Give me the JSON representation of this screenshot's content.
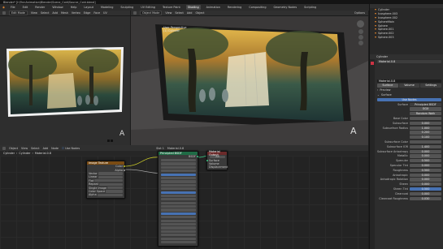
{
  "window_title": "Blender* [I:\\FinnAnimation\\Blender\\Scene_Cold\\Source_Cold.blend]",
  "menu": [
    "File",
    "Edit",
    "Render",
    "Window",
    "Help"
  ],
  "workspaces": [
    "Layout",
    "Modeling",
    "Sculpting",
    "UV Editing",
    "Texture Paint",
    "Shading",
    "Animation",
    "Rendering",
    "Compositing",
    "Geometry Nodes",
    "Scripting"
  ],
  "active_workspace": "Shading",
  "scene": "Scene",
  "view_layer": "ViewLayer",
  "left_view": {
    "header": {
      "mode": "Edit Mode",
      "menus": [
        "View",
        "Select",
        "Add",
        "Mesh",
        "Vertex",
        "Edge",
        "Face",
        "UV"
      ]
    },
    "label": "A"
  },
  "right_view": {
    "header": {
      "mode": "Object Mode",
      "menus": [
        "View",
        "Select",
        "Add",
        "Object"
      ],
      "shading": "Options"
    },
    "overlay_title": "User Perspective",
    "overlay_subtitle": "(1) Cylinder",
    "label": "A"
  },
  "outliner": {
    "items": [
      "Cylinder",
      "Icosphere.003",
      "Icosphere.002",
      "SphereMain",
      "Sphere",
      "Sphere.001",
      "Sphere.002",
      "Sphere.003"
    ]
  },
  "properties": {
    "object_name": "Cylinder",
    "material_slot": "Material.0.8",
    "material_name": "Material.0.8",
    "tabs": [
      "Surface",
      "Volume",
      "Settings"
    ],
    "sections": [
      "Preview",
      "Surface"
    ],
    "use_nodes": "Use Nodes",
    "surface_label": "Surface",
    "surface_value": "Principled BSDF",
    "rows": [
      {
        "label": "",
        "value": "GGX"
      },
      {
        "label": "",
        "value": "Random Walk"
      },
      {
        "label": "Base Color",
        "value": ""
      },
      {
        "label": "Subsurface",
        "value": "0.000"
      },
      {
        "label": "Subsurface Radius",
        "value": "1.000"
      },
      {
        "label": "",
        "value": "0.200"
      },
      {
        "label": "",
        "value": "0.100"
      },
      {
        "label": "Subsurface Color",
        "value": ""
      },
      {
        "label": "Subsurface IOR",
        "value": "1.400"
      },
      {
        "label": "Subsurface Anisotropy",
        "value": "0.000"
      },
      {
        "label": "Metallic",
        "value": "0.000"
      },
      {
        "label": "Specular",
        "value": "0.500"
      },
      {
        "label": "Specular Tint",
        "value": "0.000"
      },
      {
        "label": "Roughness",
        "value": "0.500"
      },
      {
        "label": "Anisotropic",
        "value": "0.000"
      },
      {
        "label": "Anisotropic Rotation",
        "value": "0.000"
      },
      {
        "label": "Sheen",
        "value": "0.000"
      },
      {
        "label": "Sheen Tint",
        "value": "0.500"
      },
      {
        "label": "Clearcoat",
        "value": "0.000"
      },
      {
        "label": "Clearcoat Roughness",
        "value": "0.030"
      }
    ]
  },
  "node_editor": {
    "header": {
      "type": "Object",
      "menus": [
        "View",
        "Select",
        "Add",
        "Node"
      ],
      "use_nodes": "Use Nodes",
      "slot": "Slot 1",
      "material": "Material.0.8"
    },
    "breadcrumb": [
      "Cylinder",
      "Cylinder",
      "Material.0.8"
    ],
    "image_node": {
      "title": "Image Texture",
      "color_label": "Color",
      "alpha_label": "Alpha",
      "rows": [
        "Vector",
        "Linear",
        "Flat",
        "Repeat",
        "Single Image",
        "Color Space",
        "Alpha"
      ]
    },
    "bsdf_node": {
      "title": "Principled BSDF",
      "out": "BSDF"
    },
    "output_node": {
      "title": "Material Output",
      "options": [
        "All",
        "Surface",
        "Volume",
        "Displacement"
      ]
    }
  },
  "colors": {
    "accent": "#4772b3",
    "orange": "#f08c2e",
    "header": "#303030"
  }
}
